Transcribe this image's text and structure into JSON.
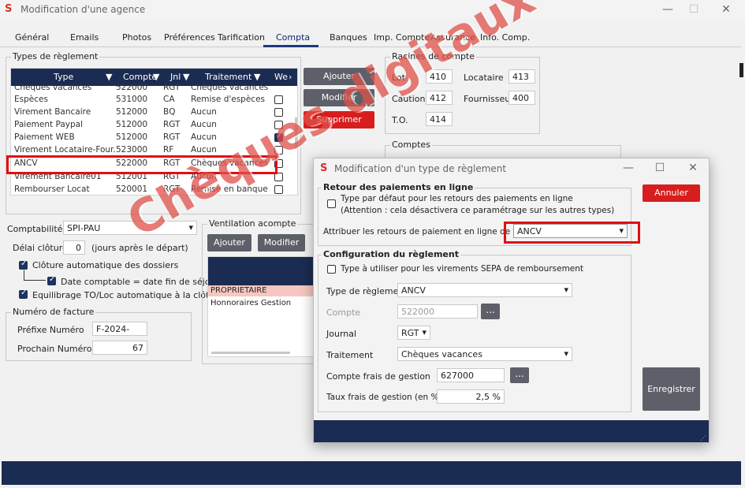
{
  "window": {
    "title": "Modification d'une agence",
    "minimize": "—",
    "maximize": "☐",
    "close": "✕"
  },
  "tabs": [
    "Général",
    "Emails",
    "Photos",
    "Préférences",
    "Tarification",
    "Compta",
    "Banques",
    "Imp. Compte",
    "Assurance",
    "Info. Comp."
  ],
  "active_tab": "Compta",
  "types_reglement": {
    "title": "Types de règlement",
    "headers": [
      "Type",
      "Compte",
      "Jnl",
      "Traitement",
      "We"
    ],
    "rows": [
      {
        "type": "Chèques vacances",
        "compte": "522000",
        "jnl": "RGT",
        "traitement": "Chèques vacances",
        "web": false
      },
      {
        "type": "Espèces",
        "compte": "531000",
        "jnl": "CA",
        "traitement": "Remise d'espèces",
        "web": false
      },
      {
        "type": "Virement Bancaire",
        "compte": "512000",
        "jnl": "BQ",
        "traitement": "Aucun",
        "web": false
      },
      {
        "type": "Paiement Paypal",
        "compte": "512000",
        "jnl": "RGT",
        "traitement": "Aucun",
        "web": false
      },
      {
        "type": "Paiement WEB",
        "compte": "512000",
        "jnl": "RGT",
        "traitement": "Aucun",
        "web": true
      },
      {
        "type": "Virement Locataire-Four.",
        "compte": "523000",
        "jnl": "RF",
        "traitement": "Aucun",
        "web": false
      },
      {
        "type": "ANCV",
        "compte": "522000",
        "jnl": "RGT",
        "traitement": "Chèques vacances",
        "web": false
      },
      {
        "type": "Virement Bancaire01",
        "compte": "512001",
        "jnl": "RGT",
        "traitement": "Aucun",
        "web": false
      },
      {
        "type": "Rembourser Locat",
        "compte": "520001",
        "jnl": "RGT",
        "traitement": "Remise en banque",
        "web": false
      }
    ],
    "buttons": {
      "add": "Ajouter",
      "edit": "Modifier",
      "delete": "Supprimer"
    }
  },
  "racines": {
    "title": "Racines de compte",
    "lot_label": "Lot",
    "lot_value": "410",
    "locataire_label": "Locataire",
    "locataire_value": "413",
    "caution_label": "Caution",
    "caution_value": "412",
    "fournisseur_label": "Fournisseur",
    "fournisseur_value": "400",
    "to_label": "T.O.",
    "to_value": "414"
  },
  "comptes_title": "Comptes",
  "comptabilite": {
    "label": "Comptabilité :",
    "value": "SPI-PAU",
    "delai_label": "Délai clôture",
    "delai_value": "0",
    "delai_suffix": "(jours après le départ)",
    "cloture_auto": "Clôture automatique des dossiers",
    "date_comptable": "Date comptable = date fin de séjour",
    "equilibrage": "Equilibrage TO/Loc automatique à la clôture"
  },
  "facture": {
    "title": "Numéro de facture",
    "prefixe_label": "Préfixe Numéro",
    "prefixe_value": "F-2024-",
    "prochain_label": "Prochain Numéro",
    "prochain_value": "67"
  },
  "ventilation": {
    "title": "Ventilation acompte",
    "add": "Ajouter",
    "edit": "Modifier",
    "rows": [
      "PROPRIETAIRE",
      "Honnoraires Gestion"
    ]
  },
  "dialog": {
    "title": "Modification d'un type de règlement",
    "retour_title": "Retour des paiements en ligne",
    "retour_chk": "Type par défaut pour les retours des paiements en ligne",
    "retour_note": "(Attention : cela désactivera ce paramétrage sur les autres types)",
    "retour_label": "Attribuer les retours de paiement en ligne de type",
    "retour_value": "ANCV",
    "config_title": "Configuration du règlement",
    "sepa_chk": "Type à utiliser pour les virements SEPA de remboursement",
    "type_label": "Type de règlement",
    "type_value": "ANCV",
    "compte_label": "Compte",
    "compte_value": "522000",
    "journal_label": "Journal",
    "journal_value": "RGT",
    "traitement_label": "Traitement",
    "traitement_value": "Chèques vacances",
    "frais_label": "Compte frais de gestion",
    "frais_value": "627000",
    "taux_label": "Taux frais de gestion (en %)",
    "taux_value": "2,5 %",
    "annuler": "Annuler",
    "enregistrer": "Enregistrer",
    "dots": "..."
  },
  "watermark": "Chèques digitaux",
  "colors": {
    "accent": "#1b2c52",
    "danger": "#d71d1d",
    "highlight": "#e01010"
  }
}
